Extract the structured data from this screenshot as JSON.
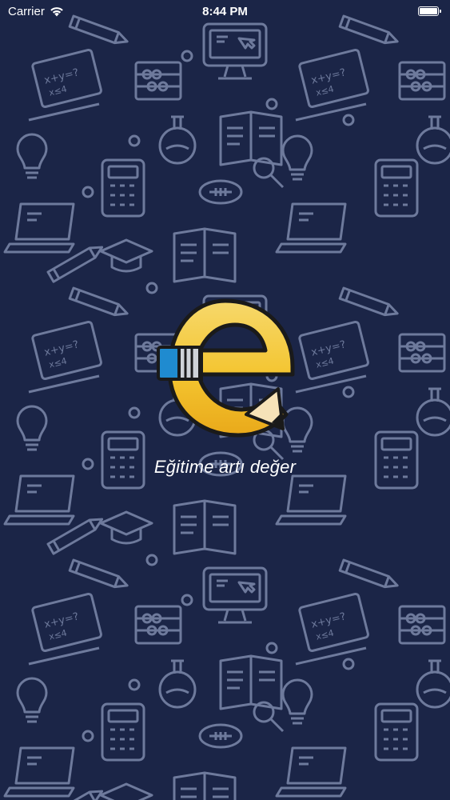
{
  "status_bar": {
    "carrier": "Carrier",
    "time": "8:44 PM",
    "battery_level": 1.0,
    "wifi_icon": "wifi-icon",
    "battery_icon": "battery-icon"
  },
  "splash": {
    "logo_icon": "pencil-e-logo-icon",
    "slogan": "Eğitime artı değer"
  },
  "colors": {
    "background": "#1b2547",
    "pattern_stroke": "#6e7a9c",
    "logo_yellow": "#f4c530",
    "logo_blue": "#1f8bd0",
    "text": "#ffffff"
  },
  "pattern": {
    "doodle_texts": [
      "x+y=?",
      "x≤4"
    ]
  }
}
